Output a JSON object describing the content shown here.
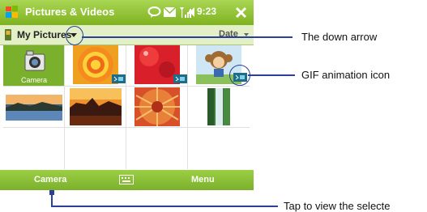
{
  "titlebar": {
    "app_title": "Pictures & Videos",
    "time": "9:23"
  },
  "folderbar": {
    "folder_name": "My Pictures",
    "sort_label": "Date"
  },
  "grid": {
    "camera_label": "Camera"
  },
  "softkeys": {
    "left": "Camera",
    "right": "Menu"
  },
  "callouts": {
    "down_arrow": "The down arrow",
    "gif_icon": "GIF animation icon",
    "tap_view": "Tap to view the selecte"
  },
  "colors": {
    "titlebar_green": "#8cc23a",
    "softkey_green": "#7bb02c",
    "callout_blue": "#2c3f9a"
  }
}
